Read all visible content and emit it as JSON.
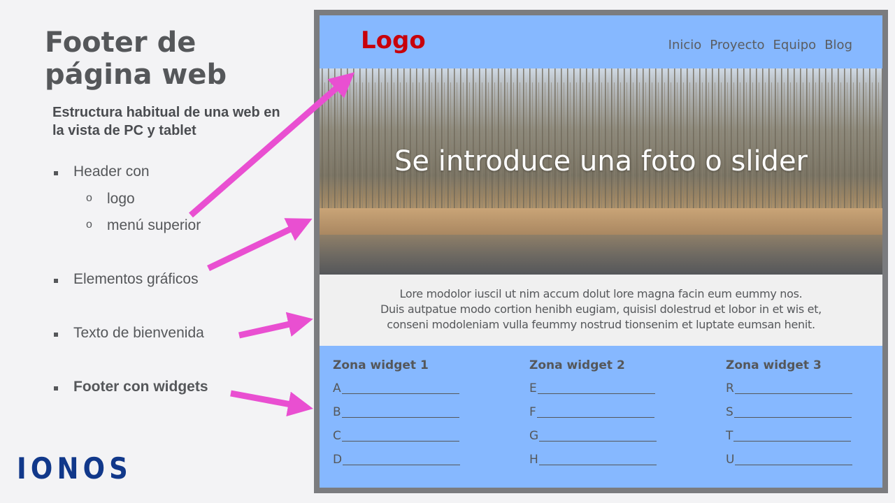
{
  "title": "Footer de página web",
  "subtitle": "Estructura habitual de una web en la vista de PC y tablet",
  "bullets": {
    "header": "Header con",
    "header_logo": "logo",
    "header_menu": "menú superior",
    "graphics": "Elementos gráficos",
    "welcome": "Texto de bienvenida",
    "footer": "Footer con widgets"
  },
  "brand": "IONOS",
  "mockup": {
    "logo": "Logo",
    "nav": [
      "Inicio",
      "Proyecto",
      "Equipo",
      "Blog"
    ],
    "hero_text": "Se introduce una foto o slider",
    "welcome_lines": [
      "Lore modolor iuscil ut nim accum dolut lore magna facin eum eummy nos.",
      "Duis autpatue modo cortion henibh eugiam, quisisl dolestrud et lobor in et wis et,",
      "conseni modoleniam vulla feummy nostrud tionsenim et luptate eumsan henit."
    ],
    "widgets": [
      {
        "title": "Zona widget 1",
        "items": [
          "A",
          "B",
          "C",
          "D"
        ]
      },
      {
        "title": "Zona widget 2",
        "items": [
          "E",
          "F",
          "G",
          "H"
        ]
      },
      {
        "title": "Zona widget 3",
        "items": [
          "R",
          "S",
          "T",
          "U"
        ]
      }
    ]
  },
  "colors": {
    "arrow": "#e94fd1",
    "mock_blue": "#86b8ff",
    "logo_red": "#c8000a",
    "brand_blue": "#11388a"
  }
}
